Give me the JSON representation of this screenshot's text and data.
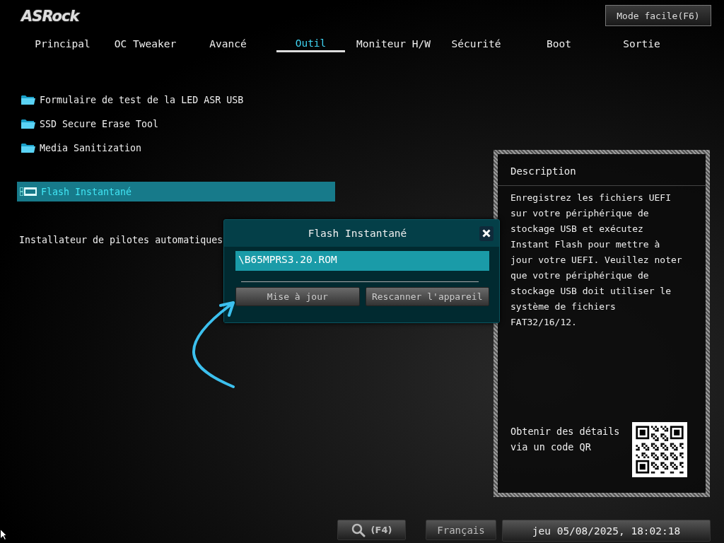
{
  "logo": "ASRock",
  "mode_button": "Mode facile(F6)",
  "tabs": [
    {
      "label": "Principal",
      "selected": false
    },
    {
      "label": "OC Tweaker",
      "selected": false
    },
    {
      "label": "Avancé",
      "selected": false
    },
    {
      "label": "Outil",
      "selected": true
    },
    {
      "label": "Moniteur H/W",
      "selected": false
    },
    {
      "label": "Sécurité",
      "selected": false
    },
    {
      "label": "Boot",
      "selected": false
    },
    {
      "label": "Sortie",
      "selected": false
    }
  ],
  "items": [
    {
      "kind": "folder",
      "label": "Formulaire de test de la LED ASR USB",
      "selected": false
    },
    {
      "kind": "folder",
      "label": "SSD Secure Erase Tool",
      "selected": false
    },
    {
      "kind": "folder",
      "label": "Media Sanitization",
      "selected": false
    },
    {
      "kind": "bios",
      "label": "Flash Instantané",
      "selected": true
    },
    {
      "kind": "text",
      "label": "Installateur de pilotes automatiques",
      "selected": false
    }
  ],
  "description": {
    "title": "Description",
    "text": "Enregistrez les fichiers UEFI sur votre périphérique de stockage USB et exécutez Instant Flash pour mettre à jour votre UEFI. Veuillez noter que votre périphérique de stockage USB doit utiliser le système de fichiers FAT32/16/12.",
    "qr_caption": "Obtenir des détails via un code QR"
  },
  "dialog": {
    "title": "Flash Instantané",
    "file": "\\B65MPRS3.20.ROM",
    "buttons": [
      "Mise à jour",
      "Rescanner l'appareil"
    ]
  },
  "footer": {
    "search_key": "(F4)",
    "language": "Français",
    "datetime": "jeu 05/08/2025, 18:02:18"
  }
}
